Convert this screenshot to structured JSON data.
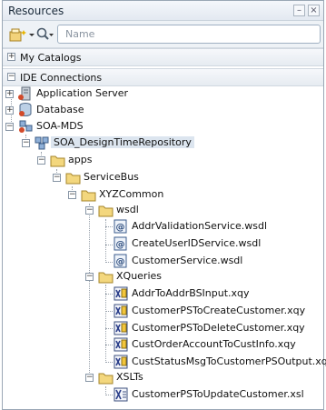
{
  "panel": {
    "title": "Resources",
    "minimize": "–",
    "close": "×"
  },
  "toolbar": {
    "search_placeholder": "Name"
  },
  "sections": {
    "my_catalogs": "My Catalogs",
    "ide_connections": "IDE Connections"
  },
  "tree": {
    "application_server": "Application Server",
    "database": "Database",
    "soa_mds": "SOA-MDS",
    "repository": "SOA_DesignTimeRepository",
    "apps": "apps",
    "servicebus": "ServiceBus",
    "xyzcommon": "XYZCommon",
    "wsdl": "wsdl",
    "wsdl_files": [
      "AddrValidationService.wsdl",
      "CreateUserIDService.wsdl",
      "CustomerService.wsdl"
    ],
    "xqueries": "XQueries",
    "xquery_files": [
      "AddrToAddrBSInput.xqy",
      "CustomerPSToCreateCustomer.xqy",
      "CustomerPSToDeleteCustomer.xqy",
      "CustOrderAccountToCustInfo.xqy",
      "CustStatusMsgToCustomerPSOutput.xqy"
    ],
    "xslts": "XSLTs",
    "xslt_files": [
      "CustomerPSToUpdateCustomer.xsl"
    ]
  }
}
